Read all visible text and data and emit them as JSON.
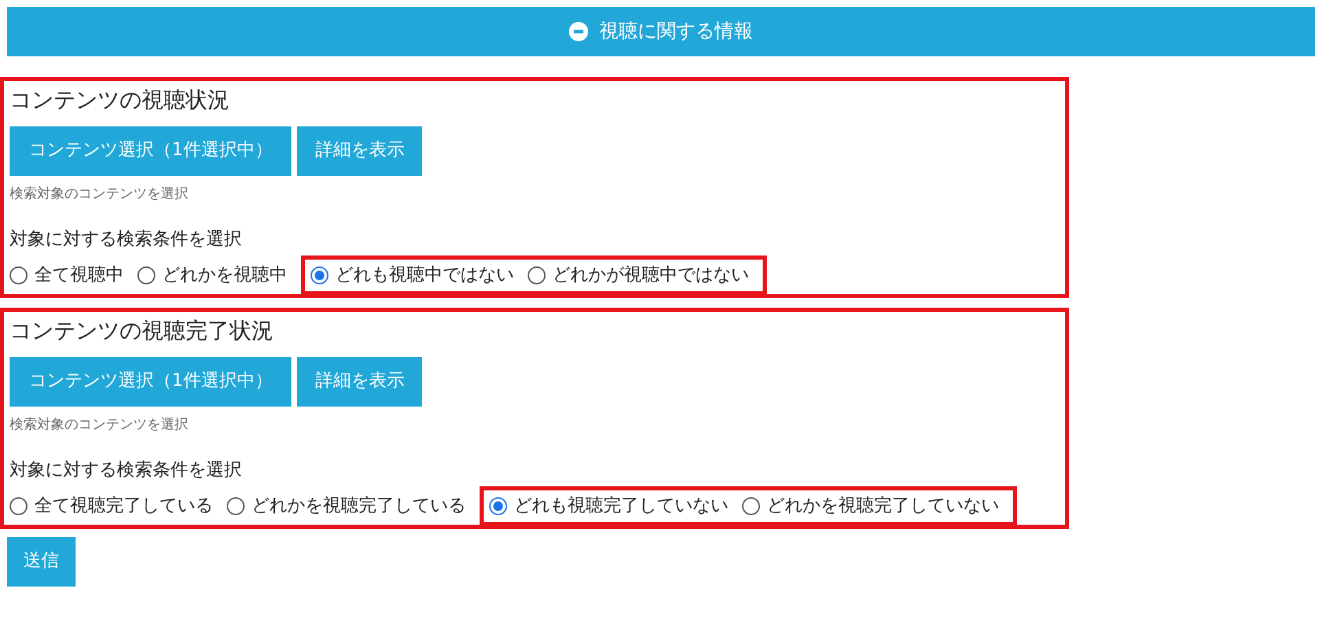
{
  "header": {
    "title": "視聴に関する情報",
    "expanded": true
  },
  "sections": [
    {
      "title": "コンテンツの視聴状況",
      "select_button": "コンテンツ選択（1件選択中）",
      "detail_button": "詳細を表示",
      "hint": "検索対象のコンテンツを選択",
      "condition_label": "対象に対する検索条件を選択",
      "options": [
        {
          "label": "全て視聴中",
          "selected": false,
          "highlighted": false
        },
        {
          "label": "どれかを視聴中",
          "selected": false,
          "highlighted": false
        },
        {
          "label": "どれも視聴中ではない",
          "selected": true,
          "highlighted": true
        },
        {
          "label": "どれかが視聴中ではない",
          "selected": false,
          "highlighted": true
        }
      ]
    },
    {
      "title": "コンテンツの視聴完了状況",
      "select_button": "コンテンツ選択（1件選択中）",
      "detail_button": "詳細を表示",
      "hint": "検索対象のコンテンツを選択",
      "condition_label": "対象に対する検索条件を選択",
      "options": [
        {
          "label": "全て視聴完了している",
          "selected": false,
          "highlighted": false
        },
        {
          "label": "どれかを視聴完了している",
          "selected": false,
          "highlighted": false
        },
        {
          "label": "どれも視聴完了していない",
          "selected": true,
          "highlighted": true
        },
        {
          "label": "どれかを視聴完了していない",
          "selected": false,
          "highlighted": true
        }
      ]
    }
  ],
  "submit_button": "送信"
}
